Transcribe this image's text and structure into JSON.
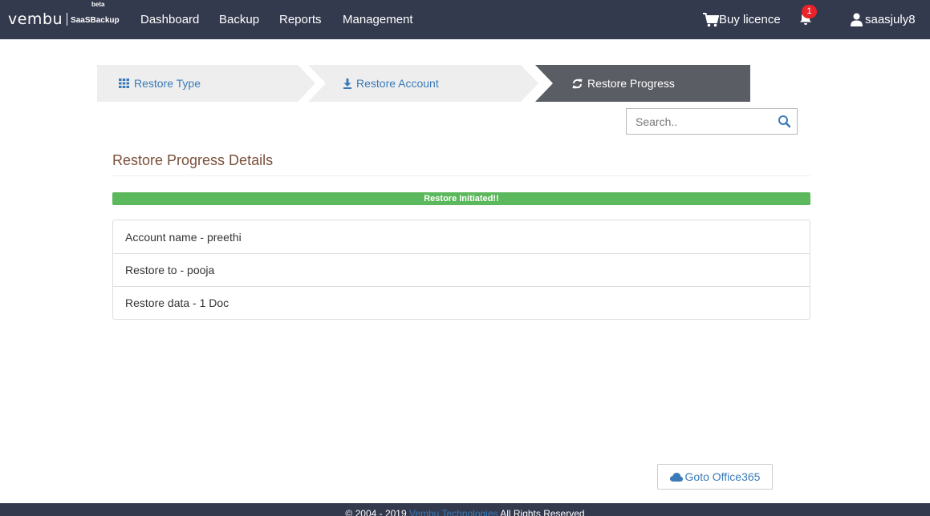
{
  "header": {
    "logo_text": "vembu",
    "logo_product": "SaaSBackup",
    "logo_badge": "beta",
    "nav": [
      "Dashboard",
      "Backup",
      "Reports",
      "Management"
    ],
    "buy_licence": "Buy licence",
    "notification_count": "1",
    "username": "saasjuly8"
  },
  "steps": [
    {
      "label": "Restore Type",
      "icon": "grid-icon"
    },
    {
      "label": "Restore Account",
      "icon": "download-icon"
    },
    {
      "label": "Restore Progress",
      "icon": "refresh-icon",
      "active": true
    }
  ],
  "search": {
    "placeholder": "Search.."
  },
  "section_title": "Restore Progress Details",
  "progress": {
    "label": "Restore Initiated!!",
    "percent": 100,
    "color": "#5cb85c"
  },
  "details": [
    "Account name - preethi",
    "Restore to - pooja",
    "Restore data - 1 Doc"
  ],
  "goto_button": "Goto Office365",
  "footer": {
    "copyright": "© 2004 - 2019 ",
    "company": "Vembu Technologies",
    "rights": " All Rights Reserved"
  },
  "colors": {
    "header_bg": "#343a4e",
    "link": "#3a7ab8",
    "step_inactive": "#eeeeee",
    "step_active": "#5a5d63",
    "title": "#7a4f3b"
  }
}
